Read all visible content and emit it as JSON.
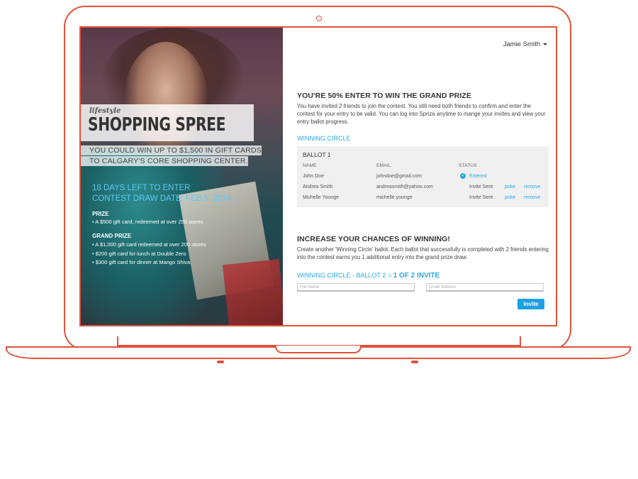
{
  "user_menu": {
    "name": "Jamie Smith"
  },
  "promo": {
    "brand": "lifestyle",
    "title": "SHOPPING SPREE",
    "win_line1": "YOU COULD WIN UP TO $1,500 IN GIFT CARDS",
    "win_line2": "TO CALGARY'S CORE SHOPPING CENTER.",
    "days_left": "18 DAYS LEFT TO ENTER",
    "draw_date": "CONTEST DRAW DATE: FEB 5, 2014",
    "prize_heading": "PRIZE",
    "prize_items": [
      "• A $500 gift card, redeemed at over 250 stores"
    ],
    "grand_heading": "GRAND PRIZE",
    "grand_items": [
      "• A $1,000 gift card redeemed at over 200 stores",
      "• $200 gift card for lunch at Double Zero",
      "• $300 gift card for dinner at Mango Shiva"
    ]
  },
  "entry": {
    "heading": "YOU'RE 50% ENTER TO WIN THE GRAND PRIZE",
    "description": "You have invited 2 friends to join the contest. You still need both friends to confirm and enter the contest for your entry to be valid. You can log into Spriza anytime to mange your invites and view your entry ballot progress."
  },
  "winning_circle": {
    "label": "WINNING CIRCLE",
    "ballot_title": "BALLOT 1",
    "columns": [
      "NAME",
      "EMAIL",
      "STATUS"
    ],
    "rows": [
      {
        "name": "John Doe",
        "email": "johndoe@gmail.com",
        "status": "Entered",
        "poke": "",
        "remove": ""
      },
      {
        "name": "Andrea Smith",
        "email": "andreasmith@yahoo.com",
        "status": "Invite Sent",
        "poke": "poke",
        "remove": "remove"
      },
      {
        "name": "Michelle Younge",
        "email": "michelle younge",
        "status": "Invite Sent",
        "poke": "poke",
        "remove": "remove"
      }
    ]
  },
  "increase": {
    "heading": "INCREASE YOUR CHANCES OF WINNING!",
    "description": "Create another 'Winning Circle' ballot. Each ballot that successfully is completed with 2 friends entering into the contest earns you 1 additional entry into the grand prize draw."
  },
  "ballot2": {
    "label": "WINNING CIRCLE - BALLOT 2 = ",
    "count": "1 OF 2 INVITE",
    "name_placeholder": "Full Name",
    "email_placeholder": "Email Address",
    "invite_label": "Invite"
  }
}
